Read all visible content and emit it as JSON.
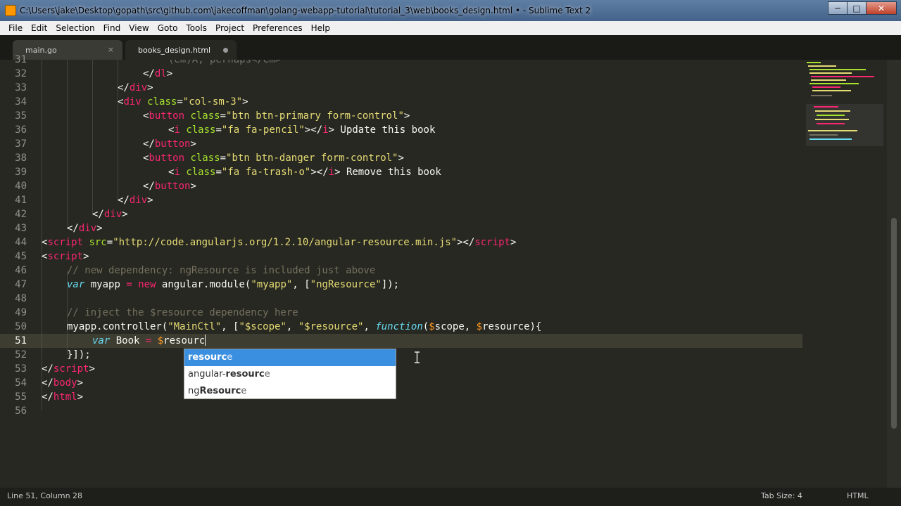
{
  "window": {
    "title": "C:\\Users\\jake\\Desktop\\gopath\\src\\github.com\\jakecoffman\\golang-webapp-tutorial\\tutorial_3\\web\\books_design.html • - Sublime Text 2",
    "minimize": "─",
    "maximize": "□",
    "close": "✕"
  },
  "menu": [
    "File",
    "Edit",
    "Selection",
    "Find",
    "View",
    "Goto",
    "Tools",
    "Project",
    "Preferences",
    "Help"
  ],
  "tabs": [
    {
      "label": "main.go",
      "close": "×"
    },
    {
      "label": "books_design.html"
    }
  ],
  "gutter": {
    "partial": "31",
    "lines": [
      "32",
      "33",
      "34",
      "35",
      "36",
      "37",
      "38",
      "39",
      "40",
      "41",
      "42",
      "43",
      "44",
      "45",
      "46",
      "47",
      "48",
      "49",
      "50",
      "51",
      "52",
      "53",
      "54",
      "55",
      "56"
    ],
    "current": "51"
  },
  "code": {
    "l31": "(em)A, perhaps</em>",
    "l32": "</dl>",
    "l33": "</div>",
    "l34_tag": "div",
    "l34_attr": "class",
    "l34_val": "\"col-sm-3\"",
    "l35_tag": "button",
    "l35_attr": "class",
    "l35_val": "\"btn btn-primary form-control\"",
    "l36_tag": "i",
    "l36_attr": "class",
    "l36_val": "\"fa fa-pencil\"",
    "l36_close": "i",
    "l36_text": " Update this book",
    "l37_tag": "button",
    "l38_tag": "button",
    "l38_attr": "class",
    "l38_val": "\"btn btn-danger form-control\"",
    "l39_tag": "i",
    "l39_attr": "class",
    "l39_val": "\"fa fa-trash-o\"",
    "l39_close": "i",
    "l39_text": " Remove this book",
    "l40_tag": "button",
    "l41_tag": "div",
    "l42_tag": "div",
    "l43_tag": "div",
    "l44_tag": "script",
    "l44_attr": "src",
    "l44_val": "\"http://code.angularjs.org/1.2.10/angular-resource.min.js\"",
    "l44_close": "script",
    "l45_tag": "script",
    "l46_comment": "// new dependency: ngResource is included just above",
    "l47_kw": "var",
    "l47_name": " myapp ",
    "l47_op": "=",
    "l47_new": "new",
    "l47_call": " angular.module(",
    "l47_s1": "\"myapp\"",
    "l47_mid": ", [",
    "l47_s2": "\"ngResource\"",
    "l47_end": "]);",
    "l49_comment": "// inject the $resource dependency here",
    "l50_call": "myapp.controller(",
    "l50_s1": "\"MainCtl\"",
    "l50_mid1": ", [",
    "l50_s2": "\"$scope\"",
    "l50_c": ", ",
    "l50_s3": "\"$resource\"",
    "l50_c2": ", ",
    "l50_fn": "function",
    "l50_p1": "(",
    "l50_d1": "$",
    "l50_a1": "scope, ",
    "l50_d2": "$",
    "l50_a2": "resource){",
    "l51_kw": "var",
    "l51_name": " Book ",
    "l51_op": "=",
    "l51_d": " $",
    "l51_typed": "resourc",
    "l52": "}]);",
    "l53_tag": "script",
    "l54_tag": "body",
    "l55_tag": "html"
  },
  "autocomplete": [
    {
      "pre": "",
      "match": "resourc",
      "rest": "e"
    },
    {
      "pre": "angular-",
      "match": "resourc",
      "rest": "e"
    },
    {
      "pre": "ng",
      "match": "Resourc",
      "rest": "e"
    }
  ],
  "status": {
    "position": "Line 51, Column 28",
    "tab_size": "Tab Size: 4",
    "syntax": "HTML"
  },
  "colors": {
    "background": "#272822",
    "tag": "#f92672",
    "attribute": "#a6e22e",
    "string": "#e6db74",
    "keyword": "#66d9ef",
    "comment": "#75715e",
    "variable": "#fd971f",
    "selection": "#3b8fe0"
  }
}
